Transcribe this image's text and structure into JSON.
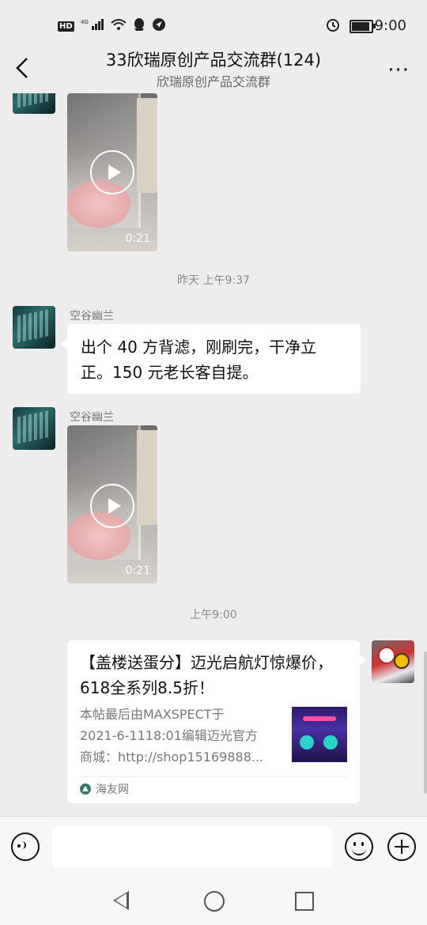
{
  "status_bar": {
    "hd": "HD",
    "network": "4G",
    "time": "9:00",
    "battery_level": 0.85
  },
  "header": {
    "title": "33欣瑞原创产品交流群(124)",
    "subtitle": "欣瑞原创产品交流群",
    "more_label": "···"
  },
  "messages": {
    "video1": {
      "duration": "0:21"
    },
    "timestamp1": "昨天 上午9:37",
    "msg1": {
      "sender": "空谷幽兰",
      "lines": [
        "出个 40 方背滤，刚刷完，干净立",
        "正。150 元老长客自提。"
      ]
    },
    "video2": {
      "sender": "空谷幽兰",
      "duration": "0:21"
    },
    "timestamp2": "上午9:00",
    "card": {
      "title": "【盖楼送蛋分】迈光启航灯惊爆价，618全系列8.5折！",
      "desc_lines": [
        "本帖最后由MAXSPECT于",
        "2021-6-1118:01编辑迈光官方",
        "商城：http://shop15169888..."
      ],
      "source": "海友网"
    }
  }
}
